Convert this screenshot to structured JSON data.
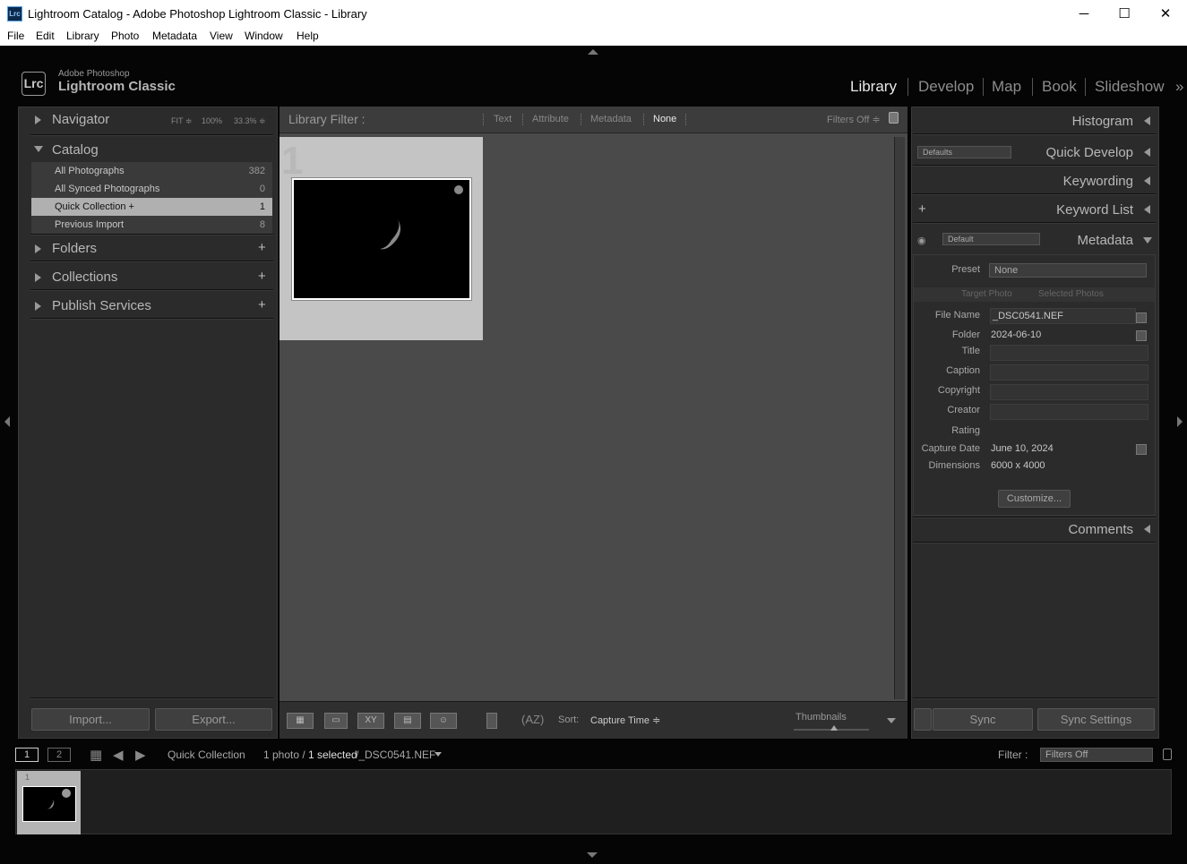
{
  "window": {
    "title": "Lightroom Catalog - Adobe Photoshop Lightroom Classic - Library",
    "app_icon": "Lrc",
    "minimize": "─",
    "maximize": "☐",
    "close": "✕"
  },
  "menu": [
    "File",
    "Edit",
    "Library",
    "Photo",
    "Metadata",
    "View",
    "Window",
    "Help"
  ],
  "brand": {
    "logo": "Lrc",
    "line1": "Adobe Photoshop",
    "line2": "Lightroom Classic"
  },
  "modules": [
    "Library",
    "Develop",
    "Map",
    "Book",
    "Slideshow"
  ],
  "modules_more": "»",
  "left_panel": {
    "navigator": {
      "title": "Navigator",
      "opt1": "FIT ≑",
      "opt2": "100%",
      "opt3": "33.3% ≑"
    },
    "catalog": {
      "title": "Catalog",
      "items": [
        {
          "label": "All Photographs",
          "count": "382"
        },
        {
          "label": "All Synced Photographs",
          "count": "0"
        },
        {
          "label": "Quick Collection +",
          "count": "1"
        },
        {
          "label": "Previous Import",
          "count": "8"
        }
      ]
    },
    "folders": "Folders",
    "collections": "Collections",
    "publish": "Publish Services",
    "import_btn": "Import...",
    "export_btn": "Export..."
  },
  "filter_bar": {
    "label": "Library Filter :",
    "options": [
      "Text",
      "Attribute",
      "Metadata",
      "None"
    ],
    "filters_off": "Filters Off ≑"
  },
  "grid": {
    "cell_number": "1"
  },
  "toolbar": {
    "sort_label": "Sort:",
    "sort_value": "Capture Time ≑",
    "thumbnails": "Thumbnails"
  },
  "right_panel": {
    "histogram": "Histogram",
    "quick_develop": "Quick Develop",
    "quick_develop_preset": "Defaults",
    "keywording": "Keywording",
    "keyword_list": "Keyword List",
    "metadata": "Metadata",
    "metadata_preset_select": "Default",
    "preset_label": "Preset",
    "preset_value": "None",
    "target_photo": "Target Photo",
    "selected_photos": "Selected Photos",
    "fields": {
      "file_name_label": "File Name",
      "file_name": "_DSC0541.NEF",
      "folder_label": "Folder",
      "folder": "2024-06-10",
      "title_label": "Title",
      "caption_label": "Caption",
      "copyright_label": "Copyright",
      "creator_label": "Creator",
      "rating_label": "Rating",
      "capture_date_label": "Capture Date",
      "capture_date": "June 10, 2024",
      "dimensions_label": "Dimensions",
      "dimensions": "6000 x 4000"
    },
    "customize_btn": "Customize...",
    "comments": "Comments",
    "sync_btn": "Sync",
    "sync_settings_btn": "Sync Settings"
  },
  "filmstrip": {
    "view1": "1",
    "view2": "2",
    "source": "Quick Collection",
    "count_prefix": "1 photo /",
    "selected": "1 selected",
    "file": "/_DSC0541.NEF",
    "filter_label": "Filter :",
    "filter_value": "Filters Off",
    "thumb_number": "1"
  }
}
